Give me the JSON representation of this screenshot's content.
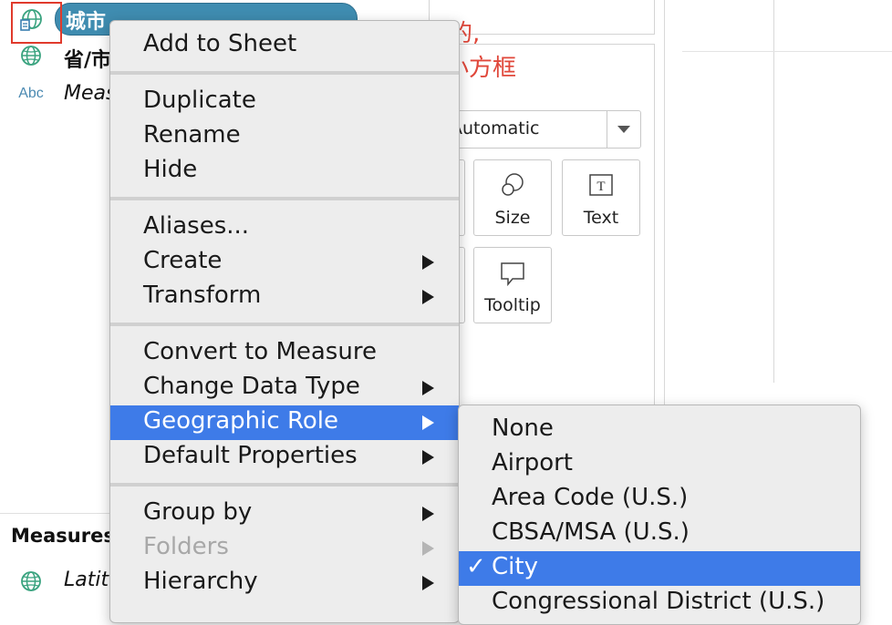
{
  "data_pane": {
    "fields": [
      {
        "label": "城市",
        "type_icon": "geo-globe-expanded-icon",
        "selected": true
      },
      {
        "label": "省/市",
        "type_icon": "geo-globe-icon"
      },
      {
        "label": "Meas",
        "type_icon": "abc-string-icon",
        "type_text": "Abc"
      }
    ],
    "measures_header": "Measures",
    "measures_fields": [
      {
        "label": "Latit",
        "type_icon": "geo-globe-icon"
      }
    ]
  },
  "annotation": {
    "line1": "如果是扩展的,",
    "line2": "下方会有一个小方框"
  },
  "marks_card": {
    "mark_type": "Automatic",
    "buttons": [
      {
        "label": "Size",
        "icon": "size-circles-icon"
      },
      {
        "label": "Text",
        "icon": "text-T-icon"
      },
      {
        "label": "Tooltip",
        "icon": "tooltip-bubble-icon"
      }
    ]
  },
  "context_menu": {
    "items": [
      {
        "label": "Add to Sheet"
      },
      {
        "label": "Duplicate"
      },
      {
        "label": "Rename"
      },
      {
        "label": "Hide"
      },
      {
        "label": "Aliases..."
      },
      {
        "label": "Create",
        "submenu": true
      },
      {
        "label": "Transform",
        "submenu": true
      },
      {
        "label": "Convert to Measure"
      },
      {
        "label": "Change Data Type",
        "submenu": true
      },
      {
        "label": "Geographic Role",
        "submenu": true,
        "highlighted": true
      },
      {
        "label": "Default Properties",
        "submenu": true
      },
      {
        "label": "Group by",
        "submenu": true
      },
      {
        "label": "Folders",
        "submenu": true,
        "disabled": true
      },
      {
        "label": "Hierarchy",
        "submenu": true
      }
    ]
  },
  "geographic_role_submenu": {
    "checkmark": "✓",
    "items": [
      {
        "label": "None"
      },
      {
        "label": "Airport"
      },
      {
        "label": "Area Code (U.S.)"
      },
      {
        "label": "CBSA/MSA (U.S.)"
      },
      {
        "label": "City",
        "checked": true
      },
      {
        "label": "Congressional District (U.S.)"
      }
    ]
  },
  "colors": {
    "pill": "#3f8cb0",
    "highlight": "#3e7be8",
    "annotation": "#e0473a",
    "red_box": "#e03a2c",
    "menu_bg": "#ededed"
  }
}
